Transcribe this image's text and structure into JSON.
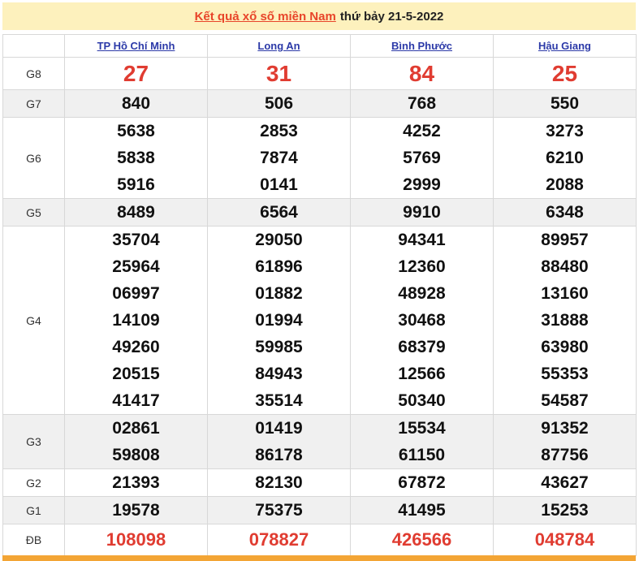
{
  "header": {
    "link_text": "Kết quả xổ số miền Nam",
    "date_text": "thứ bảy 21-5-2022"
  },
  "provinces": [
    "TP Hồ Chí Minh",
    "Long An",
    "Bình Phước",
    "Hậu Giang"
  ],
  "prizes": [
    {
      "label": "G8",
      "values": [
        [
          "27"
        ],
        [
          "31"
        ],
        [
          "84"
        ],
        [
          "25"
        ]
      ]
    },
    {
      "label": "G7",
      "values": [
        [
          "840"
        ],
        [
          "506"
        ],
        [
          "768"
        ],
        [
          "550"
        ]
      ]
    },
    {
      "label": "G6",
      "values": [
        [
          "5638",
          "5838",
          "5916"
        ],
        [
          "2853",
          "7874",
          "0141"
        ],
        [
          "4252",
          "5769",
          "2999"
        ],
        [
          "3273",
          "6210",
          "2088"
        ]
      ]
    },
    {
      "label": "G5",
      "values": [
        [
          "8489"
        ],
        [
          "6564"
        ],
        [
          "9910"
        ],
        [
          "6348"
        ]
      ]
    },
    {
      "label": "G4",
      "values": [
        [
          "35704",
          "25964",
          "06997",
          "14109",
          "49260",
          "20515",
          "41417"
        ],
        [
          "29050",
          "61896",
          "01882",
          "01994",
          "59985",
          "84943",
          "35514"
        ],
        [
          "94341",
          "12360",
          "48928",
          "30468",
          "68379",
          "12566",
          "50340"
        ],
        [
          "89957",
          "88480",
          "13160",
          "31888",
          "63980",
          "55353",
          "54587"
        ]
      ]
    },
    {
      "label": "G3",
      "values": [
        [
          "02861",
          "59808"
        ],
        [
          "01419",
          "86178"
        ],
        [
          "15534",
          "61150"
        ],
        [
          "91352",
          "87756"
        ]
      ]
    },
    {
      "label": "G2",
      "values": [
        [
          "21393"
        ],
        [
          "82130"
        ],
        [
          "67872"
        ],
        [
          "43627"
        ]
      ]
    },
    {
      "label": "G1",
      "values": [
        [
          "19578"
        ],
        [
          "75375"
        ],
        [
          "41495"
        ],
        [
          "15253"
        ]
      ]
    },
    {
      "label": "ĐB",
      "values": [
        [
          "108098"
        ],
        [
          "078827"
        ],
        [
          "426566"
        ],
        [
          "048784"
        ]
      ]
    }
  ]
}
